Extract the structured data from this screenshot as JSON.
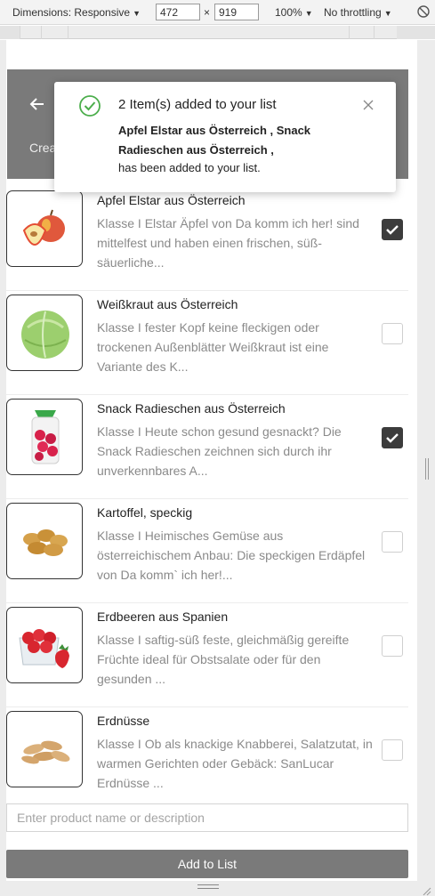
{
  "devtools": {
    "dimensions_label": "Dimensions: Responsive",
    "width": "472",
    "times": "×",
    "height": "919",
    "zoom": "100%",
    "throttling": "No throttling"
  },
  "header": {
    "subtitle_partial": "Crea"
  },
  "toast": {
    "title": "2 Item(s) added to your list",
    "items_line1": "Apfel Elstar aus Österreich , Snack",
    "items_line2": "Radieschen aus Österreich ,",
    "message": "has been added to your list.",
    "accent_color": "#4cae4c"
  },
  "products": [
    {
      "name": "Apfel Elstar aus Österreich",
      "desc": "Klasse I Elstar Äpfel von Da komm ich her! sind mittelfest und haben einen frischen, süß-säuerliche...",
      "checked": true,
      "image": "apple-image"
    },
    {
      "name": "Weißkraut aus Österreich",
      "desc": "Klasse I fester Kopf keine fleckigen oder trockenen Außenblätter Weißkraut ist eine Variante des K...",
      "checked": false,
      "image": "cabbage-image"
    },
    {
      "name": "Snack Radieschen aus Österreich",
      "desc": "Klasse I Heute schon gesund gesnackt? Die Snack Radieschen zeichnen sich durch ihr unverkennbares A...",
      "checked": true,
      "image": "radish-bag-image"
    },
    {
      "name": "Kartoffel, speckig",
      "desc": "Klasse I Heimisches Gemüse aus österreichischem Anbau: Die speckigen Erdäpfel von Da komm` ich her!...",
      "checked": false,
      "image": "potatoes-image"
    },
    {
      "name": "Erdbeeren aus Spanien",
      "desc": "Klasse I saftig-süß feste, gleichmäßig gereifte Früchte ideal für Obstsalate oder für den gesunden ...",
      "checked": false,
      "image": "strawberries-image"
    },
    {
      "name": "Erdnüsse",
      "desc": "Klasse I Ob als knackige Knabberei, Salatzutat, in warmen Gerichten oder Gebäck: SanLucar Erdnüsse ...",
      "checked": false,
      "image": "peanuts-image"
    }
  ],
  "form": {
    "placeholder": "Enter product name or description",
    "value": "",
    "button_label": "Add to List"
  },
  "colors": {
    "header_bg": "#7a7a7a",
    "checkbox_checked": "#3c3c3c",
    "button_bg": "#7a7a7a"
  }
}
